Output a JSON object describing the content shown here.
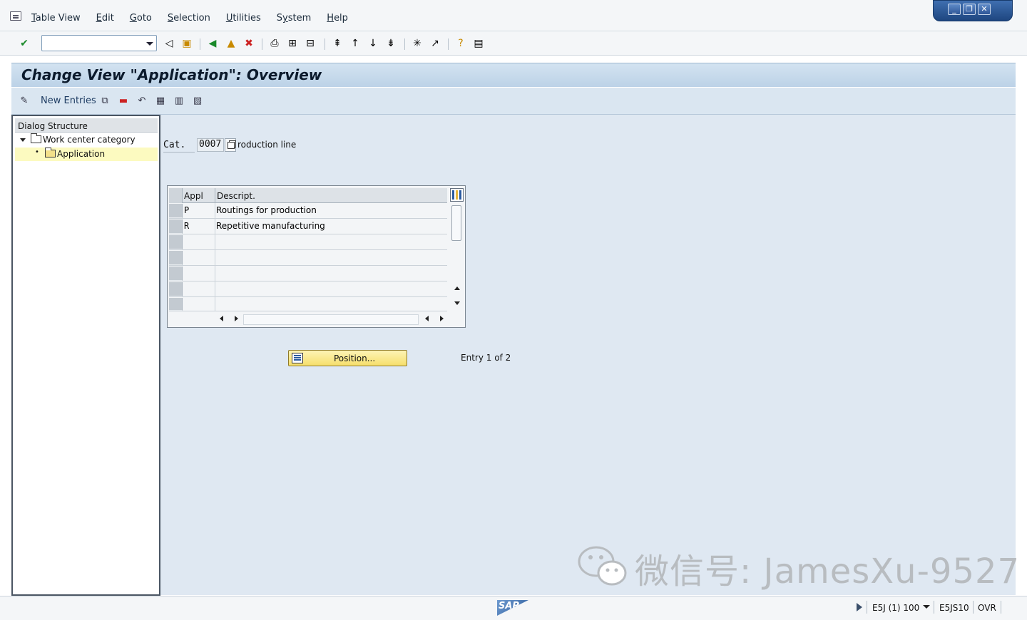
{
  "menu": {
    "items": [
      {
        "label_pre": "",
        "label_u": "T",
        "label_post": "able View"
      },
      {
        "label_pre": "",
        "label_u": "E",
        "label_post": "dit"
      },
      {
        "label_pre": "",
        "label_u": "G",
        "label_post": "oto"
      },
      {
        "label_pre": "",
        "label_u": "S",
        "label_post": "election"
      },
      {
        "label_pre": "",
        "label_u": "U",
        "label_post": "tilities"
      },
      {
        "label_pre": "S",
        "label_u": "y",
        "label_post": "stem"
      },
      {
        "label_pre": "",
        "label_u": "H",
        "label_post": "elp"
      }
    ]
  },
  "window": {
    "minimize": "_",
    "restore": "❐",
    "close": "✕"
  },
  "toolbar": {
    "command_value": ""
  },
  "title": "Change View \"Application\": Overview",
  "app_toolbar": {
    "new_entries": "New Entries"
  },
  "dialog_structure": {
    "header": "Dialog Structure",
    "items": [
      {
        "label": "Work center category"
      },
      {
        "label": "Application"
      }
    ]
  },
  "cat": {
    "label": "Cat.",
    "value": "0007",
    "description": "roduction line"
  },
  "table": {
    "headers": {
      "appl": "Appl",
      "descript": "Descript."
    },
    "rows": [
      {
        "appl": "P",
        "descript": "Routings for production"
      },
      {
        "appl": "R",
        "descript": "Repetitive manufacturing"
      },
      {
        "appl": "",
        "descript": ""
      },
      {
        "appl": "",
        "descript": ""
      },
      {
        "appl": "",
        "descript": ""
      },
      {
        "appl": "",
        "descript": ""
      },
      {
        "appl": "",
        "descript": ""
      }
    ]
  },
  "position_button": "Position...",
  "entry_info": "Entry 1 of 2",
  "watermark": "微信号: JamesXu-9527",
  "status": {
    "sap": "SAP",
    "system": "E5J (1) 100",
    "server": "E5JS10",
    "mode": "OVR"
  }
}
